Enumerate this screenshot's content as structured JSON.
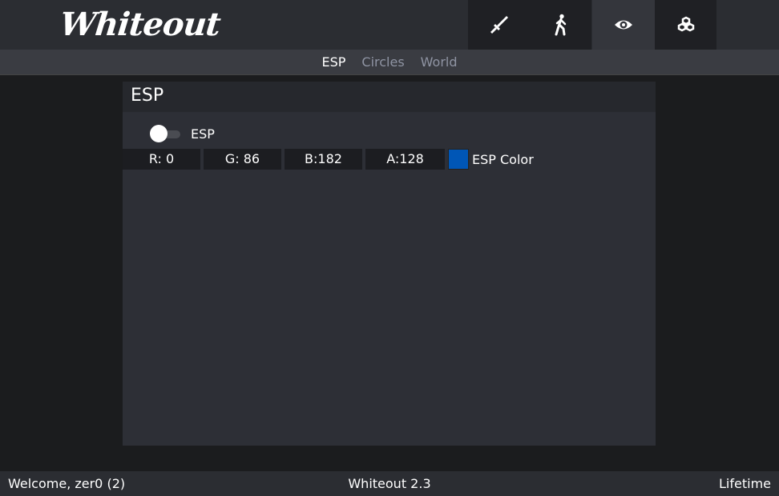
{
  "app": {
    "logo": "Whiteout"
  },
  "nav": {
    "tabs": [
      {
        "icon": "sword-icon",
        "active": false
      },
      {
        "icon": "running-man-icon",
        "active": false
      },
      {
        "icon": "eye-icon",
        "active": true
      },
      {
        "icon": "cubes-icon",
        "active": false
      }
    ]
  },
  "subtabs": [
    {
      "label": "ESP",
      "active": true
    },
    {
      "label": "Circles",
      "active": false
    },
    {
      "label": "World",
      "active": false
    }
  ],
  "panel": {
    "title": "ESP",
    "toggle": {
      "label": "ESP",
      "on": false
    },
    "color": {
      "r": "R:  0",
      "g": "G: 86",
      "b": "B:182",
      "a": "A:128",
      "swatch": "#0056b6",
      "label": "ESP Color"
    }
  },
  "footer": {
    "welcome": "Welcome, zer0 (2)",
    "version": "Whiteout 2.3",
    "license": "Lifetime"
  },
  "colors": {
    "accent_active": "#34363c",
    "panel": "#2d2f36"
  }
}
